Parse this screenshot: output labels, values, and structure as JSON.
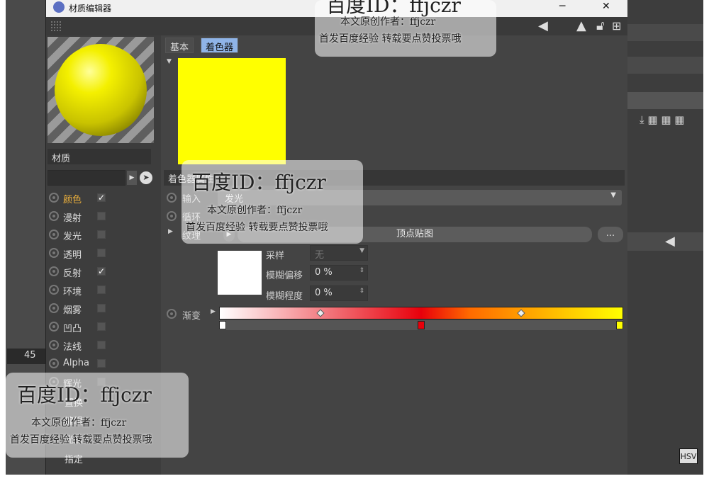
{
  "window": {
    "title": "材质编辑器",
    "controls": [
      "─",
      "✕"
    ]
  },
  "toolbar": {
    "icons": [
      "arrow-left-icon",
      "arrow-up-icon",
      "lock-icon",
      "add-icon"
    ]
  },
  "left": {
    "material_label": "材质",
    "channels": [
      {
        "label": "颜色",
        "checked": true,
        "active": true
      },
      {
        "label": "漫射",
        "checked": false
      },
      {
        "label": "发光",
        "checked": false
      },
      {
        "label": "透明",
        "checked": false
      },
      {
        "label": "反射",
        "checked": true
      },
      {
        "label": "环境",
        "checked": false
      },
      {
        "label": "烟雾",
        "checked": false
      },
      {
        "label": "凹凸",
        "checked": false
      },
      {
        "label": "法线",
        "checked": false
      },
      {
        "label": "Alpha",
        "checked": false
      },
      {
        "label": "辉光",
        "checked": false
      }
    ],
    "sub_items": [
      "置换",
      "编辑",
      "光照",
      "指定"
    ],
    "checkmark": "✓"
  },
  "main": {
    "tabs": [
      {
        "label": "基本",
        "active": false
      },
      {
        "label": "着色器",
        "active": true
      }
    ],
    "section_title": "着色器属性",
    "input_label": "输入",
    "input_value": "发光",
    "loop_label": "循环",
    "texture_label": "纹理",
    "texture_value": "顶点贴图",
    "dots_label": "...",
    "sample_label": "采样",
    "sample_value": "无",
    "blur_offset_label": "模糊偏移",
    "blur_offset_value": "0 %",
    "blur_scale_label": "模糊程度",
    "blur_scale_value": "0 %",
    "gradient_label": "渐变",
    "swatch_color": "#ffff00",
    "gradient_stops": [
      "#ffffff",
      "#e8000b",
      "#ffff00"
    ]
  },
  "background": {
    "frame_number": "45",
    "hsv_label": "HSV"
  },
  "watermarks": [
    {
      "id": "百度ID：ffjczr",
      "line1": "本文原创作者：ffjczr",
      "line2": "首发百度经验  转载要点赞投票哦"
    }
  ],
  "accent_color": "#f0b33c"
}
